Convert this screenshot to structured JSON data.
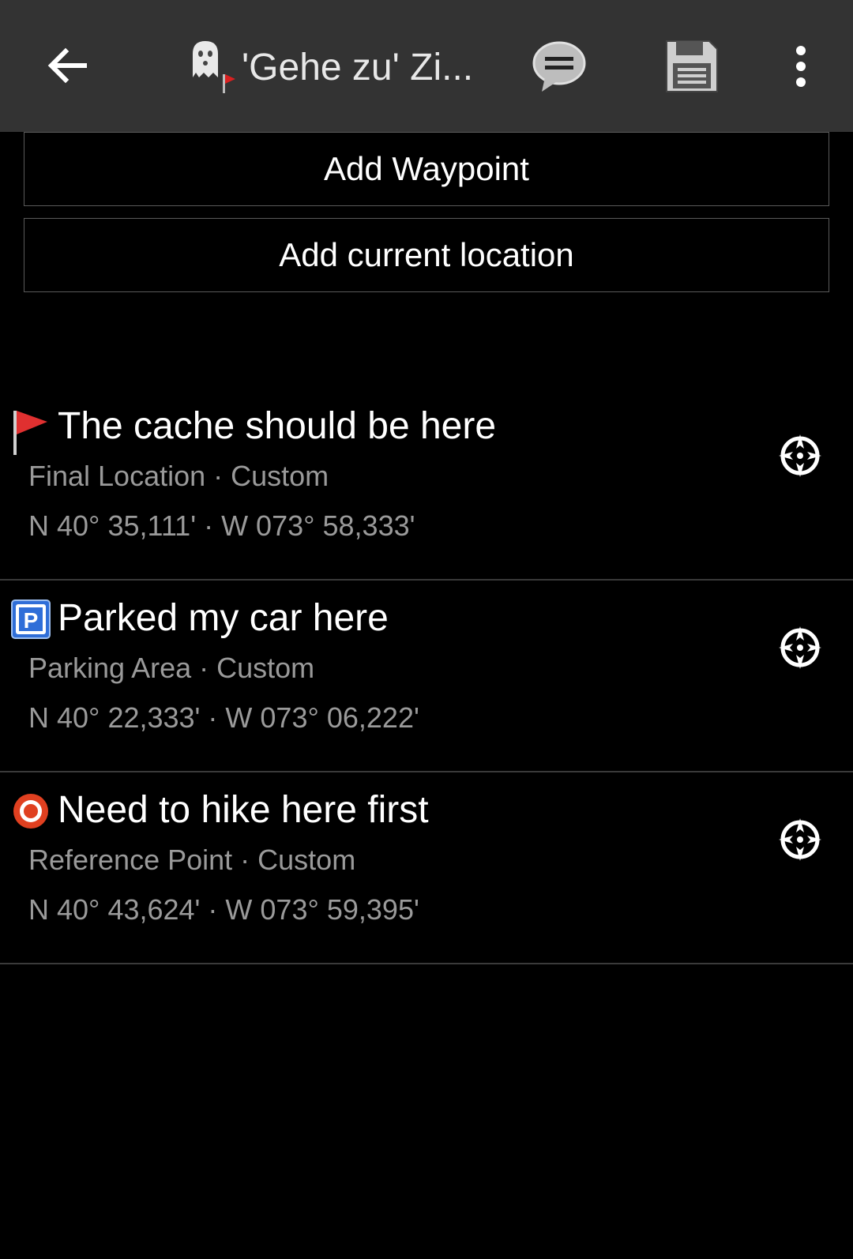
{
  "toolbar": {
    "title": "'Gehe zu' Zi...",
    "back_icon": "arrow-left-icon",
    "log_icon": "speech-bubble-icon",
    "save_icon": "floppy-disk-icon",
    "more_icon": "overflow-menu-icon"
  },
  "actions": {
    "add_waypoint": "Add Waypoint",
    "add_current_location": "Add current location"
  },
  "waypoints": [
    {
      "icon": "red-flag-icon",
      "title": "The cache should be here",
      "subtitle": "Final Location · Custom",
      "coords": "N 40° 35,111' · W 073° 58,333'"
    },
    {
      "icon": "parking-icon",
      "title": "Parked my car here",
      "subtitle": "Parking Area · Custom",
      "coords": "N 40° 22,333' · W 073° 06,222'"
    },
    {
      "icon": "reference-point-icon",
      "title": "Need to hike here first",
      "subtitle": "Reference Point · Custom",
      "coords": "N 40° 43,624' · W 073° 59,395'"
    }
  ],
  "colors": {
    "toolbar_bg": "#333333",
    "background": "#000000",
    "secondary_text": "#9a9a9a",
    "divider": "#3a3a3a"
  }
}
